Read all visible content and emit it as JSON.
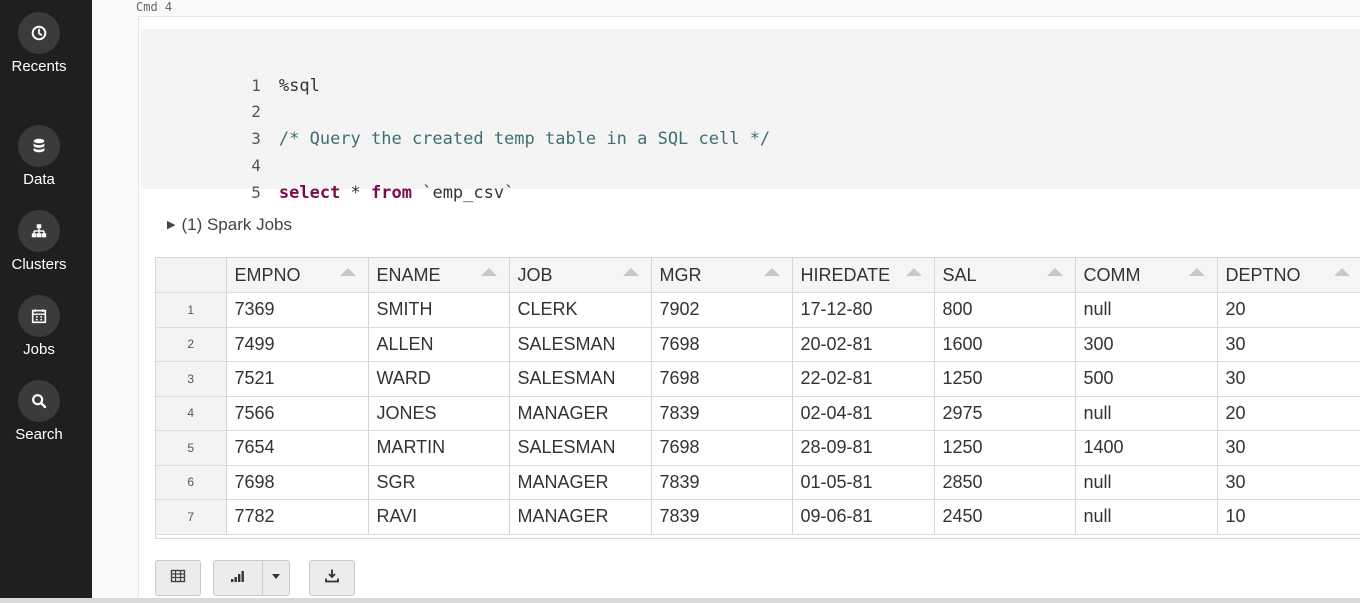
{
  "sidebar": {
    "items": [
      {
        "label": "Recents",
        "icon": "clock-icon"
      },
      {
        "label": "Data",
        "icon": "database-icon"
      },
      {
        "label": "Clusters",
        "icon": "cluster-icon"
      },
      {
        "label": "Jobs",
        "icon": "calendar-icon"
      },
      {
        "label": "Search",
        "icon": "search-icon"
      }
    ]
  },
  "cell": {
    "cmd_label": "Cmd 4",
    "code_lines": [
      {
        "num": "1",
        "text": "%sql"
      },
      {
        "num": "2",
        "text": ""
      },
      {
        "num": "3",
        "text": "/* Query the created temp table in a SQL cell */"
      },
      {
        "num": "4",
        "text": ""
      },
      {
        "num": "5",
        "kw1": "select",
        "mid": " * ",
        "kw2": "from",
        "rest": " `emp_csv`"
      }
    ],
    "spark_jobs": "(1) Spark Jobs"
  },
  "table": {
    "columns": [
      "EMPNO",
      "ENAME",
      "JOB",
      "MGR",
      "HIREDATE",
      "SAL",
      "COMM",
      "DEPTNO"
    ],
    "rows": [
      [
        "1",
        "7369",
        "SMITH",
        "CLERK",
        "7902",
        "17-12-80",
        "800",
        "null",
        "20"
      ],
      [
        "2",
        "7499",
        "ALLEN",
        "SALESMAN",
        "7698",
        "20-02-81",
        "1600",
        "300",
        "30"
      ],
      [
        "3",
        "7521",
        "WARD",
        "SALESMAN",
        "7698",
        "22-02-81",
        "1250",
        "500",
        "30"
      ],
      [
        "4",
        "7566",
        "JONES",
        "MANAGER",
        "7839",
        "02-04-81",
        "2975",
        "null",
        "20"
      ],
      [
        "5",
        "7654",
        "MARTIN",
        "SALESMAN",
        "7698",
        "28-09-81",
        "1250",
        "1400",
        "30"
      ],
      [
        "6",
        "7698",
        "SGR",
        "MANAGER",
        "7839",
        "01-05-81",
        "2850",
        "null",
        "30"
      ],
      [
        "7",
        "7782",
        "RAVI",
        "MANAGER",
        "7839",
        "09-06-81",
        "2450",
        "null",
        "10"
      ]
    ]
  },
  "toolbar": {
    "buttons": [
      "table-view-icon",
      "bar-chart-icon",
      "chevron-down-icon",
      "download-icon"
    ]
  }
}
